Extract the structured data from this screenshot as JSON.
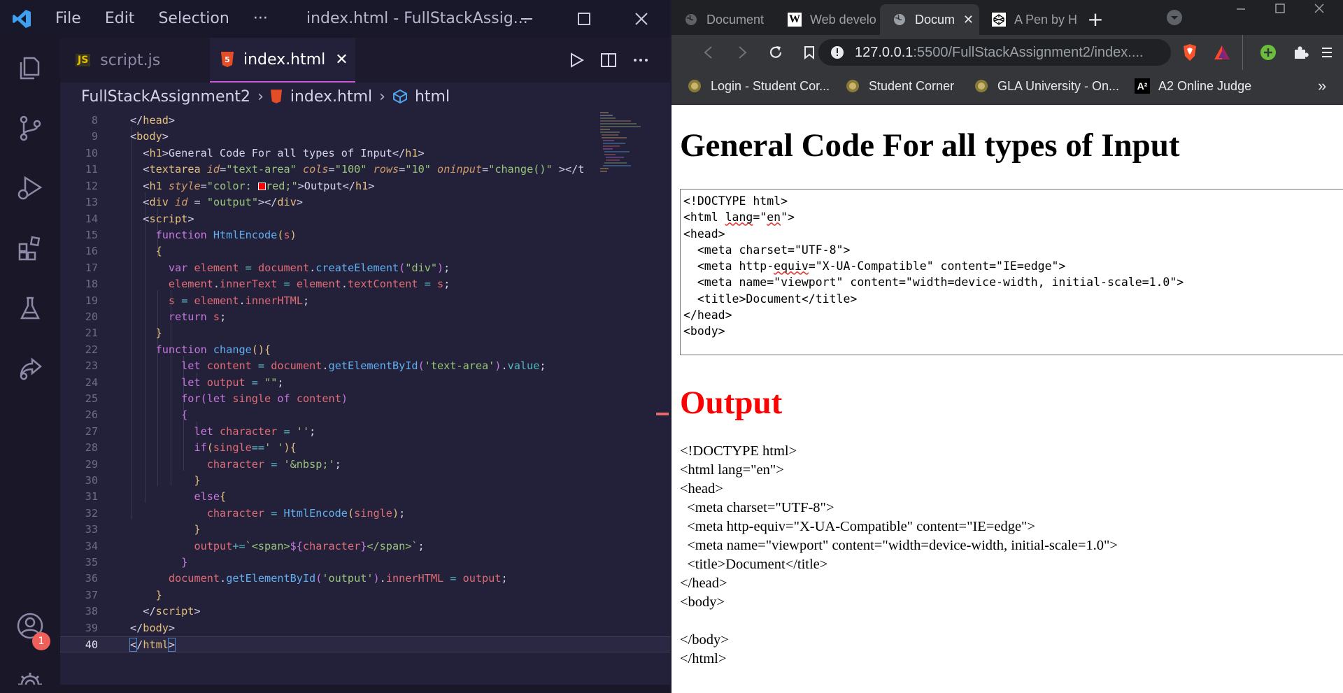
{
  "vscode": {
    "menu": [
      "File",
      "Edit",
      "Selection",
      "···"
    ],
    "window_title": "index.html - FullStackAssig...",
    "tabs": [
      {
        "icon": "JS",
        "label": "script.js"
      },
      {
        "icon": "5",
        "label": "index.html",
        "close": "✕"
      }
    ],
    "breadcrumb": [
      "FullStackAssignment2",
      "index.html",
      "html"
    ],
    "account_badge": "1",
    "line_numbers": [
      "8",
      "9",
      "10",
      "11",
      "12",
      "13",
      "14",
      "15",
      "16",
      "17",
      "18",
      "19",
      "20",
      "21",
      "22",
      "23",
      "24",
      "25",
      "26",
      "27",
      "28",
      "29",
      "30",
      "31",
      "32",
      "33",
      "34",
      "35",
      "36",
      "37",
      "38",
      "39",
      "40"
    ],
    "current_line": "40"
  },
  "browser": {
    "tabs": [
      {
        "label": "Document"
      },
      {
        "label": "Web develo"
      },
      {
        "label": "Docum",
        "close": "✕"
      },
      {
        "label": "A Pen by H"
      }
    ],
    "new_tab": "+",
    "url_host": "127.0.0.1",
    "url_path": ":5500/FullStackAssignment2/index....",
    "bookmarks": [
      "Login - Student Cor...",
      "Student Corner",
      "GLA University - On...",
      "A2 Online Judge"
    ],
    "bookmarks_more": "»",
    "page": {
      "heading": "General Code For all types of Input",
      "textarea_lines": [
        "<!DOCTYPE html>",
        "<html lang=\"en\">",
        "<head>",
        "  <meta charset=\"UTF-8\">",
        "  <meta http-equiv=\"X-UA-Compatible\" content=\"IE=edge\">",
        "  <meta name=\"viewport\" content=\"width=device-width, initial-scale=1.0\">",
        "  <title>Document</title>",
        "</head>",
        "<body>"
      ],
      "output_heading": "Output",
      "output_lines": [
        "<!DOCTYPE html>",
        "<html lang=\"en\">",
        "<head>",
        "  <meta charset=\"UTF-8\">",
        "  <meta http-equiv=\"X-UA-Compatible\" content=\"IE=edge\">",
        "  <meta name=\"viewport\" content=\"width=device-width, initial-scale=1.0\">",
        "  <title>Document</title>",
        "</head>",
        "<body>",
        "",
        "</body>",
        "</html>"
      ]
    }
  },
  "colors": {
    "accent_tab_border": "#c857d8",
    "html_icon": "#e44d26",
    "js_icon": "#e6c300",
    "output_red": "#ff0000",
    "badge": "#f0605a"
  }
}
